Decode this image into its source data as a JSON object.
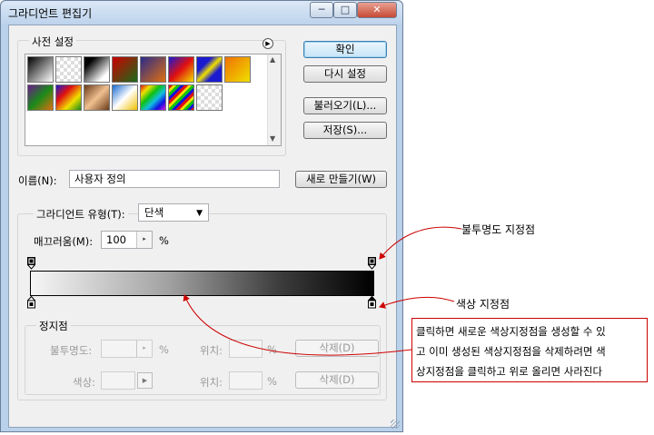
{
  "window": {
    "title": "그라디언트 편집기",
    "min_glyph": "─",
    "max_glyph": "□",
    "close_glyph": "✕"
  },
  "presets": {
    "label": "사전 설정",
    "menu_glyph": "▶",
    "scroll_up": "▲",
    "scroll_down": "▼"
  },
  "buttons": {
    "ok": "확인",
    "reset": "다시 설정",
    "load": "불러오기(L)...",
    "save": "저장(S)...",
    "new": "새로 만들기(W)"
  },
  "name": {
    "label": "이름(N):",
    "value": "사용자 정의"
  },
  "gradient": {
    "type_label": "그라디언트 유형(T):",
    "type_value": "단색",
    "type_arrow": "▼",
    "smoothness_label": "매끄러움(M):",
    "smoothness_value": "100",
    "smoothness_unit": "%",
    "stepper_glyph": "▸"
  },
  "stops": {
    "label": "정지점",
    "opacity_label": "불투명도:",
    "opacity_unit": "%",
    "location_label": "위치:",
    "location_unit": "%",
    "delete_label": "삭제(D)",
    "color_label": "색상:",
    "location2_label": "위치:",
    "location2_unit": "%",
    "delete2_label": "삭제(D)",
    "color_arrow": "▶"
  },
  "annotations": {
    "opacity_stop": "불투명도 지정점",
    "color_stop": "색상 지정점",
    "box_line1": "클릭하면 새로운 색상지정점을 생성할 수 있",
    "box_line2": "고 이미 생성된 색상지정점을 삭제하려면 색",
    "box_line3": "상지정점을 클릭하고 위로 올리면 사라진다"
  },
  "colors": {
    "annotation": "#cc0000",
    "window_frame": "#b9d1ea",
    "dialog_bg": "#f0f0f0"
  }
}
